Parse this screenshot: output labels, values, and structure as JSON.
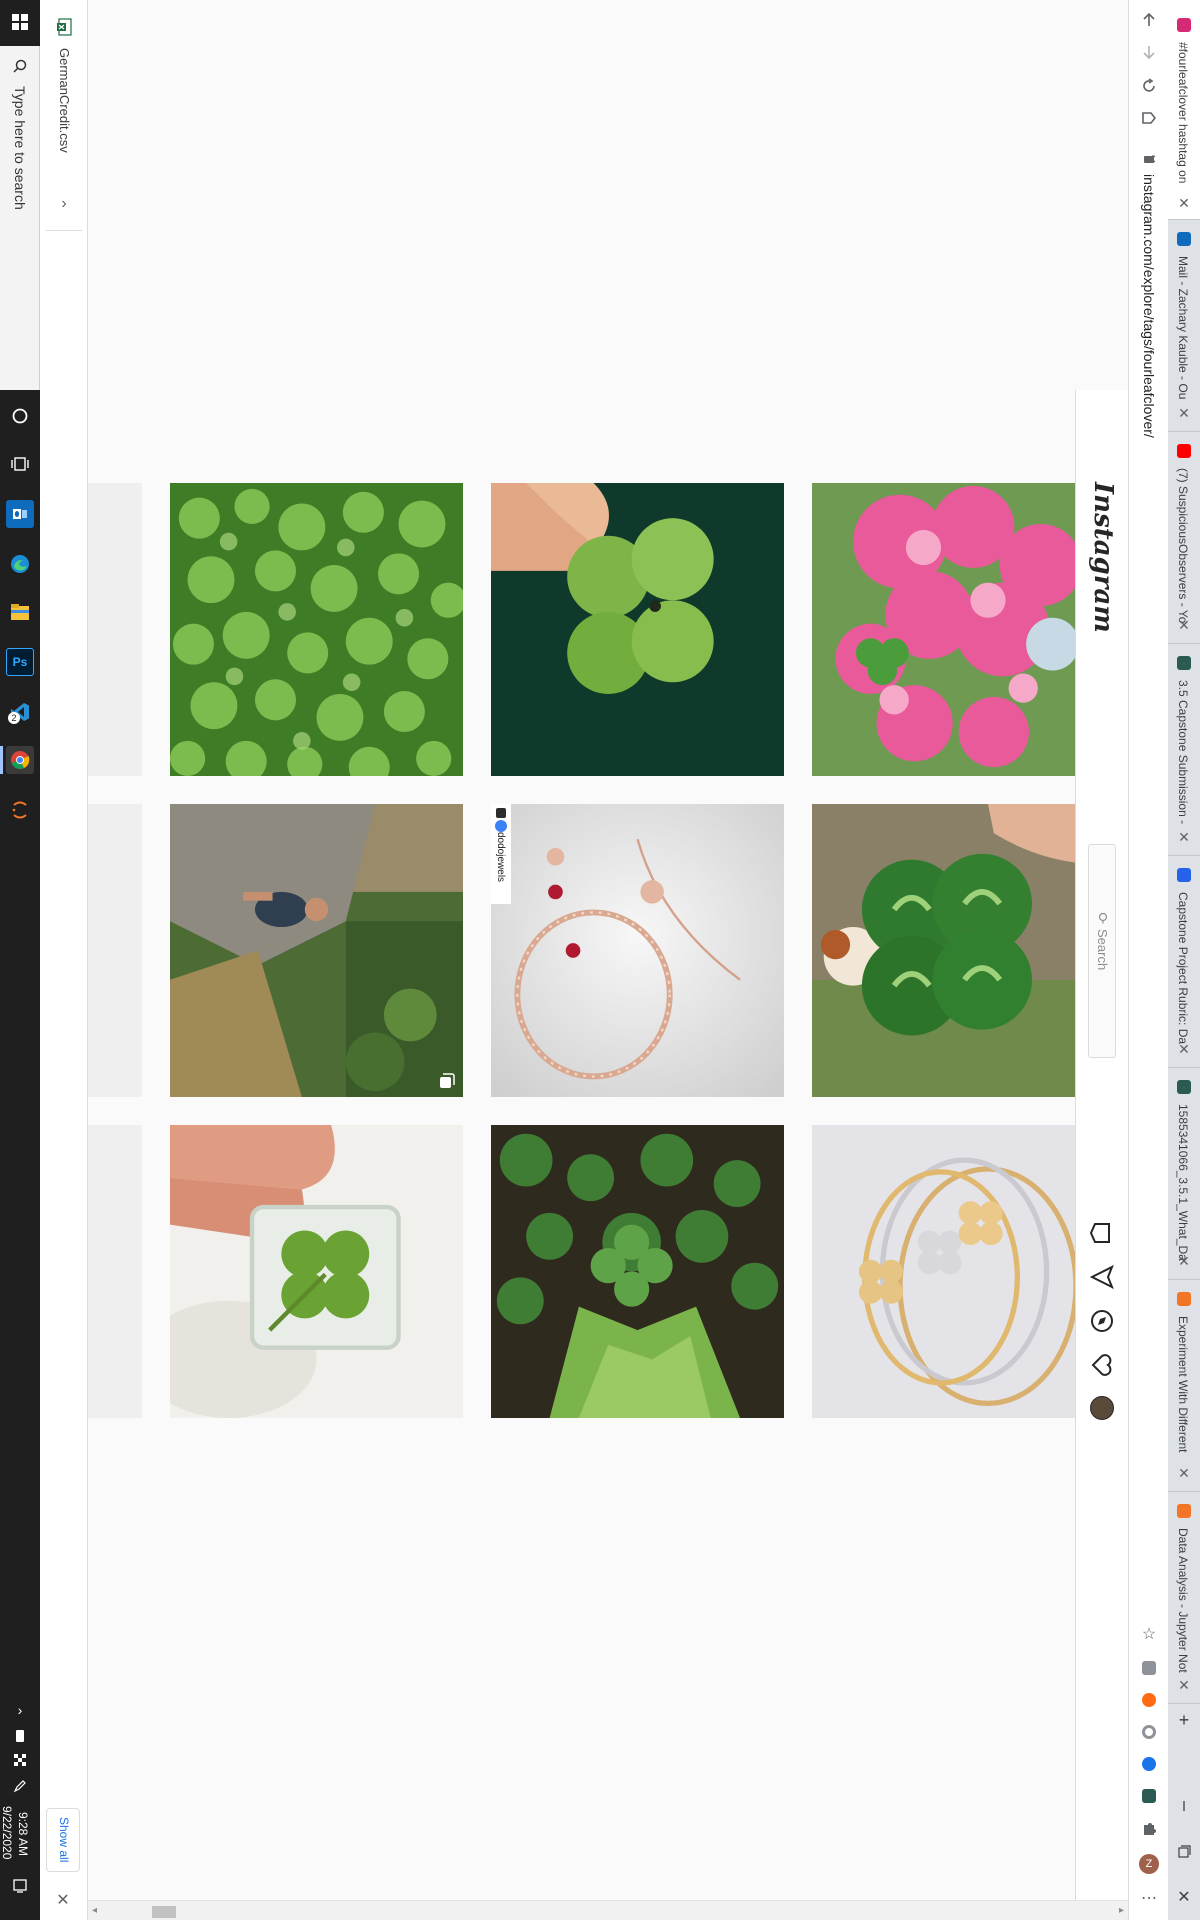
{
  "taskbar": {
    "search_placeholder": "Type here to search",
    "clock_time": "9:28 AM",
    "clock_date": "9/22/2020",
    "apps": [
      "cortana-icon",
      "task-view-icon",
      "outlook-icon",
      "edge-icon",
      "file-explorer-icon",
      "photoshop-icon",
      "vscode-icon",
      "chrome-icon",
      "jupyter-icon"
    ],
    "photoshop_glyph": "Ps",
    "vscode_badge": "2"
  },
  "downloads": {
    "file_name": "GermanCredit.csv",
    "show_all_label": "Show all"
  },
  "browser": {
    "url": "instagram.com/explore/tags/fourleafclover/",
    "tabs": [
      {
        "title": "#fourleafclover hashtag on",
        "favicon_color": "#d62976",
        "active": true
      },
      {
        "title": "Mail - Zachary Kauble - Ou",
        "favicon_color": "#0f6cbd",
        "active": false
      },
      {
        "title": "(7) SuspiciousObservers - Yo",
        "favicon_color": "#ff0000",
        "active": false
      },
      {
        "title": "3.5 Capstone Submission -",
        "favicon_color": "#2b5a52",
        "active": false
      },
      {
        "title": "Capstone Project Rubric: Da",
        "favicon_color": "#2563eb",
        "active": false
      },
      {
        "title": "1585341066_3.5.1_What_Da",
        "favicon_color": "#2b5a52",
        "active": false
      },
      {
        "title": "Experiment With Different",
        "favicon_color": "#f37626",
        "active": false
      },
      {
        "title": "Data Analysis - Jupyter Not",
        "favicon_color": "#f37626",
        "active": false
      }
    ],
    "extension_icons": [
      "bookmark-star-icon",
      "grammarly-icon",
      "honey-icon",
      "circle-extension-icon",
      "blue-extension-icon",
      "evernote-icon",
      "extensions-puzzle-icon",
      "profile-avatar-icon"
    ],
    "profile_initial": "Z",
    "new_tab_symbol": "+",
    "menu_symbol": "⋯"
  },
  "instagram": {
    "logo_text": "Instagram",
    "search_placeholder": "Search",
    "nav_icons": [
      "home-icon",
      "direct-message-icon",
      "explore-compass-icon",
      "activity-heart-icon",
      "profile-avatar-icon"
    ]
  },
  "posts": [
    {
      "scene": "clover-field",
      "label": "",
      "multi": false
    },
    {
      "scene": "held-four-leaf-clover",
      "label": "",
      "multi": false
    },
    {
      "scene": "pink-flowers-clover",
      "label": "",
      "multi": false
    },
    {
      "scene": "person-on-rock",
      "label": "",
      "multi": true
    },
    {
      "scene": "rose-gold-jewelry",
      "label": "dodojewels",
      "multi": false
    },
    {
      "scene": "large-clover-with-puppy",
      "label": "",
      "multi": false
    },
    {
      "scene": "clover-in-resin",
      "label": "",
      "multi": false
    },
    {
      "scene": "clover-patch-strawberry-leaves",
      "label": "",
      "multi": false
    },
    {
      "scene": "clover-bangles",
      "label": "",
      "multi": false
    }
  ],
  "colors": {
    "taskbar_bg": "#1f1f1f",
    "page_bg": "#fafafa",
    "tabstrip_bg": "#dee1e6",
    "clover_green": "#3f8f2e"
  }
}
